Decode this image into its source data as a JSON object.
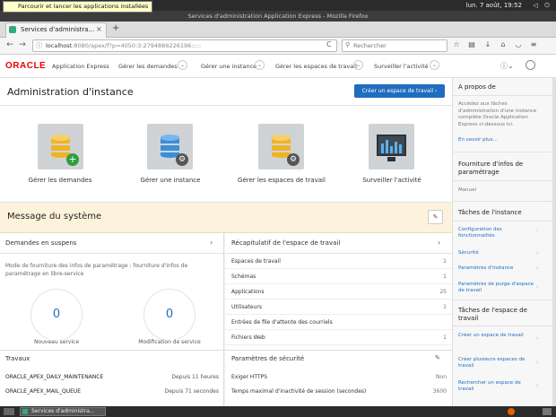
{
  "os_panel": {
    "tooltip": "Parcourir et lancer les applications installées",
    "clock": "lun. 7 août, 19:52",
    "volume_icon": "speaker-icon",
    "power_icon": "power-icon"
  },
  "browser": {
    "window_title": "Services d'administration Application Express - Mozilla Firefox",
    "tab_label": "Services d'administra...",
    "url_host": "localhost",
    "url_rest": ":8080/apex/f?p=4050:3:2794886226196:::::",
    "search_placeholder": "Rechercher"
  },
  "apex": {
    "logo": "ORACLE",
    "app_name": "Application Express",
    "menu": [
      {
        "label": "Gérer les demandes"
      },
      {
        "label": "Gérer une instance"
      },
      {
        "label": "Gérer les espaces de travail"
      },
      {
        "label": "Surveiller l'activité"
      }
    ],
    "page_title": "Administration d'instance",
    "create_button": "Créer un espace de travail ›",
    "tiles": [
      {
        "label": "Gérer les demandes",
        "icon": "database-add-icon"
      },
      {
        "label": "Gérer une instance",
        "icon": "database-gear-icon"
      },
      {
        "label": "Gérer les espaces de travail",
        "icon": "database-gear-icon"
      },
      {
        "label": "Surveiller l'activité",
        "icon": "monitor-chart-icon"
      }
    ],
    "system_message_title": "Message du système"
  },
  "pending": {
    "title": "Demandes en suspens",
    "description": "Mode de fourniture des infos de paramétrage : fourniture d'infos de paramétrage en libre-service",
    "counters": [
      {
        "value": "0",
        "label": "Nouveau service"
      },
      {
        "value": "0",
        "label": "Modification de service"
      }
    ]
  },
  "summary": {
    "title": "Récapitulatif de l'espace de travail",
    "rows": [
      {
        "label": "Espaces de travail",
        "value": "1"
      },
      {
        "label": "Schémas",
        "value": "1"
      },
      {
        "label": "Applications",
        "value": "25"
      },
      {
        "label": "Utilisateurs",
        "value": "1"
      },
      {
        "label": "Entrées de file d'attente des courriels",
        "value": ""
      },
      {
        "label": "Fichiers Web",
        "value": "1"
      }
    ]
  },
  "jobs": {
    "title": "Travaux",
    "rows": [
      {
        "name": "ORACLE_APEX_DAILY_MAINTENANCE",
        "when": "Depuis 11 heures"
      },
      {
        "name": "ORACLE_APEX_MAIL_QUEUE",
        "when": "Depuis 71 secondes"
      }
    ]
  },
  "security": {
    "title": "Paramètres de sécurité",
    "rows": [
      {
        "label": "Exiger HTTPS",
        "value": "Non"
      },
      {
        "label": "Temps maximal d'inactivité de session (secondes)",
        "value": "3600"
      }
    ]
  },
  "sidebar": {
    "about_title": "A propos de",
    "about_text": "Accédez aux tâches d'administration d'une instance complète Oracle Application Express ci-dessous ici.",
    "learn_more": "En savoir plus...",
    "provisioning_title": "Fourniture d'infos de paramétrage",
    "provisioning_value": "Manuel",
    "instance_tasks_title": "Tâches de l'instance",
    "instance_links": [
      "Configuration des fonctionnalités",
      "Sécurité",
      "Paramètres d'instance",
      "Paramètres de purge d'espace de travail"
    ],
    "workspace_tasks_title": "Tâches de l'espace de travail",
    "workspace_links": [
      "Créer un espace de travail",
      "Créer plusieurs espaces de travail",
      "Rechercher un espace de travail"
    ]
  },
  "taskbar": {
    "item_label": "Services d'administra..."
  },
  "colors": {
    "accent_blue": "#1f6dbe",
    "oracle_red": "#e00000",
    "db_yellow": "#f0b323",
    "db_blue": "#3b8fd8",
    "add_green": "#2e9e3e"
  }
}
